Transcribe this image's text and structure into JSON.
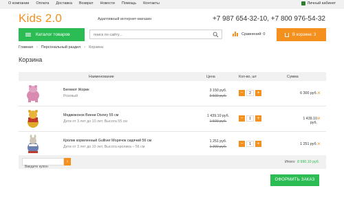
{
  "topnav": {
    "links": [
      "О компании",
      "Оплата",
      "Доставка",
      "Возврат",
      "Новости",
      "Помощь",
      "Контакты"
    ],
    "cabinet": "Личный кабинет"
  },
  "header": {
    "logo": "Kids 2.0",
    "tagline": "Адаптивный интернет-магазин",
    "phones": "+7 987 654-32-10, +7 800 976-54-32"
  },
  "nav": {
    "catalog_label": "Каталог товаров",
    "search_placeholder": "поиск по сайту...",
    "compare_label": "Сравнений: 0",
    "cart_label": "В корзине: 3"
  },
  "breadcrumb": [
    "Главная",
    "Персональный раздел",
    "Корзина"
  ],
  "page_title": "Корзина",
  "table": {
    "headers": {
      "name": "Наименование",
      "price": "Цена",
      "qty": "Кол-во, шт",
      "sum": "Сумма"
    },
    "rows": [
      {
        "name": "Бегемот Жорик",
        "desc": "Розовый",
        "price": "3 150 руб.",
        "old_price": "3 500 руб.",
        "qty": "2",
        "sum": "6 300 руб.",
        "color": "#d98ab0"
      },
      {
        "name": "Медвежонок Винни Disney 55 см",
        "desc": "Дети от 3 лет до 10 лет, Высота 55 см",
        "price": "1 439.10 руб.",
        "old_price": "1 599 руб.",
        "qty": "1",
        "sum": "1 439.10 руб.",
        "color": "#e0a92a"
      },
      {
        "name": "Кролик кормленный Gulliver Морячок сидячий 56 см",
        "desc": "Дети от 3 лет до 10 лет, Высота кролика – 56 см",
        "price": "1 251 руб.",
        "old_price": "1 390 руб.",
        "qty": "1",
        "sum": "1 251 руб.",
        "color": "#6b7fb3"
      }
    ],
    "minus": "−",
    "plus": "+",
    "remove": "×"
  },
  "footer": {
    "coupon_placeholder": "Введите купон",
    "coupon_button": "›",
    "total_label": "Итого:",
    "total_value": "8 990.10 руб."
  },
  "order_button": "ОФОРМИТЬ ЗАКАЗ",
  "colors": {
    "accent_orange": "#f3901e",
    "accent_green": "#2cbc54"
  }
}
